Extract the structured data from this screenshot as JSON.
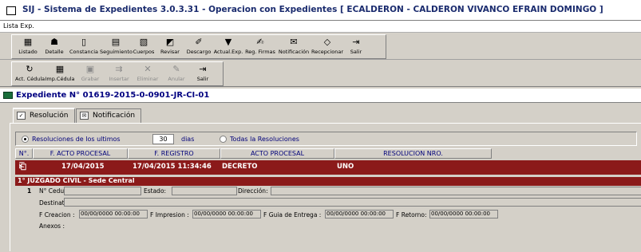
{
  "window": {
    "title": "SIJ - Sistema de Expedientes 3.0.3.31 - Operacion con Expedientes  [ ECALDERON - CALDERON VIVANCO EFRAIN DOMINGO ]"
  },
  "menu": {
    "item": "Lista Exp."
  },
  "toolbar1": [
    {
      "icon": "list-icon",
      "glyph": "▦",
      "label": "Listado"
    },
    {
      "icon": "detail-icon",
      "glyph": "☗",
      "label": "Detalle"
    },
    {
      "icon": "book-icon",
      "glyph": "▯",
      "label": "Constancia"
    },
    {
      "icon": "tracking-icon",
      "glyph": "▤",
      "label": "Seguimiento"
    },
    {
      "icon": "document-icon",
      "glyph": "▧",
      "label": "Cuerpos"
    },
    {
      "icon": "review-icon",
      "glyph": "◩",
      "label": "Revisar"
    },
    {
      "icon": "download-icon",
      "glyph": "✐",
      "label": "Descargo"
    },
    {
      "icon": "update-icon",
      "glyph": "▼",
      "label": "Actual.Exp."
    },
    {
      "icon": "signature-icon",
      "glyph": "✍",
      "label": "Reg. Firmas"
    },
    {
      "icon": "notification-icon",
      "glyph": "✉",
      "label": "Notificación"
    },
    {
      "icon": "receive-icon",
      "glyph": "◇",
      "label": "Recepcionar"
    },
    {
      "icon": "exit-icon",
      "glyph": "⇥",
      "label": "Salir"
    }
  ],
  "toolbar2": [
    {
      "icon": "notice-update-icon",
      "glyph": "↻",
      "label": "Act. Cédula",
      "enabled": true
    },
    {
      "icon": "print-notice-icon",
      "glyph": "▦",
      "label": "Imp.Cédula",
      "enabled": true
    },
    {
      "icon": "save-icon",
      "glyph": "▣",
      "label": "Grabar",
      "enabled": false
    },
    {
      "icon": "insert-icon",
      "glyph": "⇉",
      "label": "Insertar",
      "enabled": false
    },
    {
      "icon": "delete-icon",
      "glyph": "✕",
      "label": "Eliminar",
      "enabled": false
    },
    {
      "icon": "cancel-icon",
      "glyph": "✎",
      "label": "Anular",
      "enabled": false
    },
    {
      "icon": "exit-icon",
      "glyph": "⇥",
      "label": "Salir",
      "enabled": true
    }
  ],
  "expediente": {
    "title": "Expediente N° 01619-2015-0-0901-JR-CI-01"
  },
  "tabs": [
    {
      "label": "Resolución"
    },
    {
      "label": "Notificación"
    }
  ],
  "filter": {
    "last_label": "Resoluciones de los ultimos",
    "days_value": "30",
    "days_label": "dias",
    "all_label": "Todas la Resoluciones",
    "selected": "last"
  },
  "grid": {
    "headers": [
      "N°.",
      "F. ACTO PROCESAL",
      "F. REGISTRO",
      "ACTO PROCESAL",
      "RESOLUCION NRO."
    ],
    "row": {
      "fecha_acto": "17/04/2015",
      "fecha_registro": "17/04/2015 11:34:46",
      "acto": "DECRETO",
      "resolucion": "UNO"
    },
    "court": "1° JUZGADO CIVIL - Sede Central"
  },
  "detail": {
    "number": "1",
    "cedula_label": "N° Cedula",
    "estado_label": "Estado:",
    "direccion_label": "Dirección:",
    "destinatario_label": "Destinatario",
    "f_creacion_label": "F Creacion :",
    "f_creacion": "00/00/0000 00:00:00",
    "f_impresion_label": "F Impresion :",
    "f_impresion": "00/00/0000 00:00:00",
    "f_guia_label": "F Guia de Entrega :",
    "f_guia": "00/00/0000 00:00:00",
    "f_retorno_label": "F Retorno:",
    "f_retorno": "00/00/0000 00:00:00",
    "anexos_label": "Anexos :"
  },
  "colors": {
    "row_highlight": "#8b1a1a",
    "header_text": "#00007a",
    "title_text": "#1a2b6e"
  }
}
